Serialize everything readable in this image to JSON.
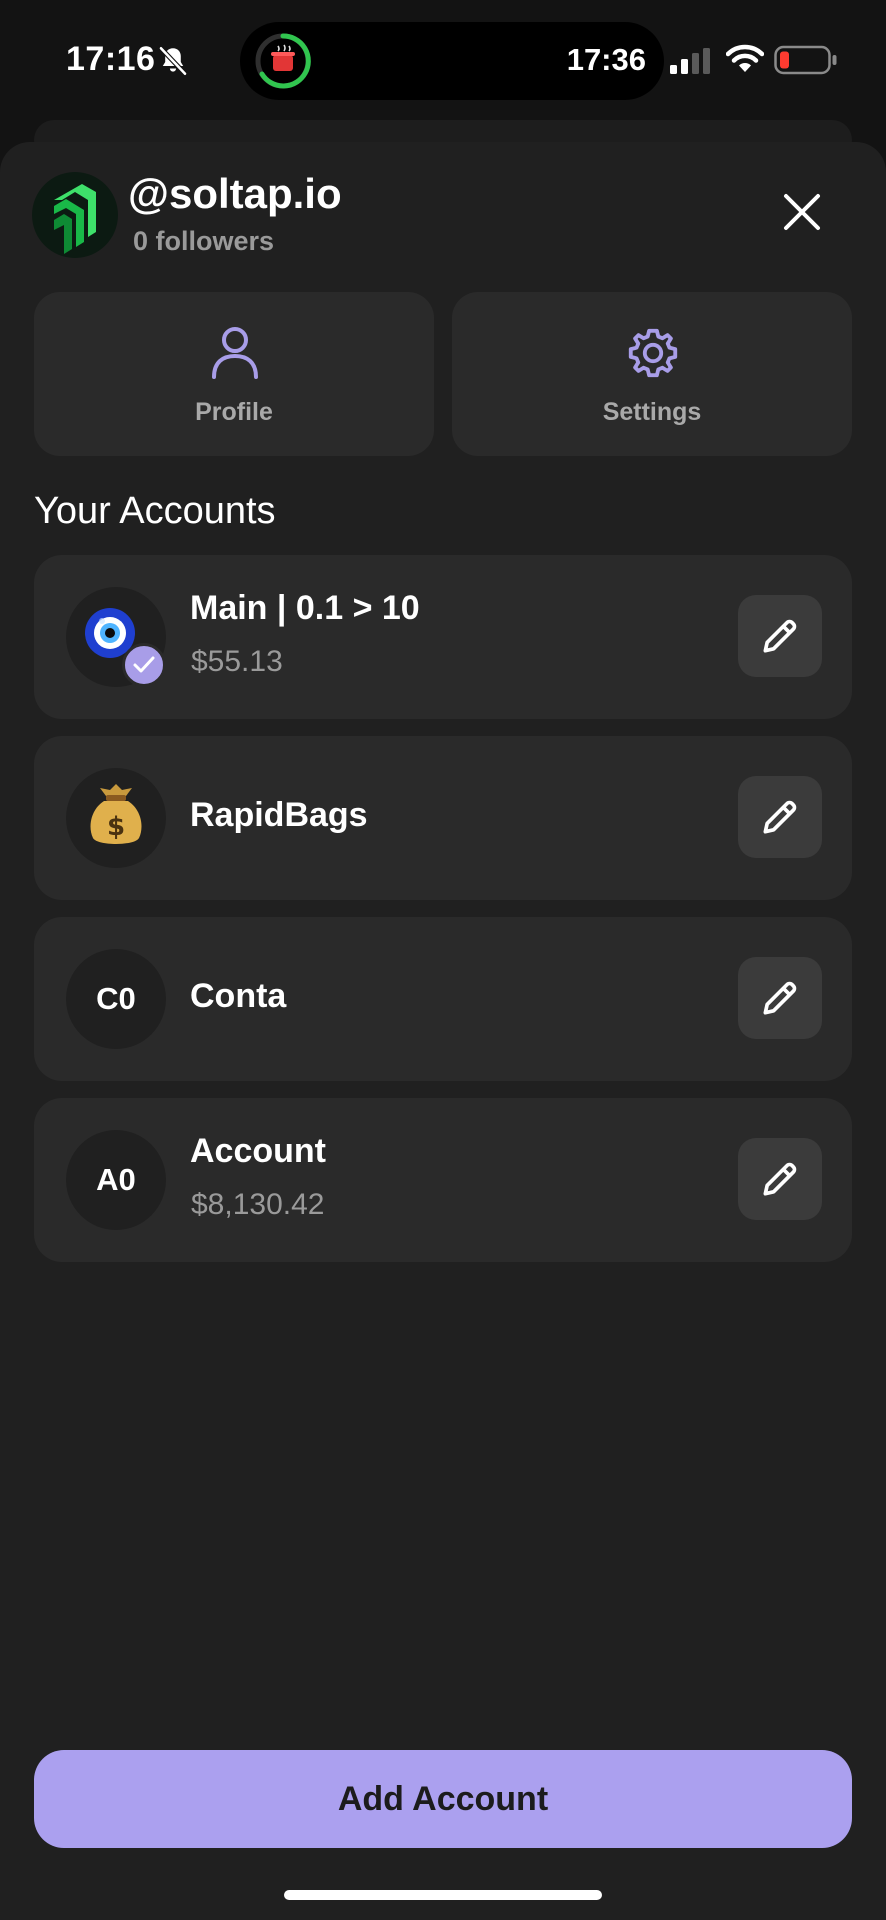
{
  "status_bar": {
    "time": "17:16",
    "island_time": "17:36",
    "icons": [
      "bell-slash-icon",
      "timer-ring-icon",
      "signal-icon",
      "wifi-icon",
      "battery-low-icon"
    ]
  },
  "profile": {
    "handle": "@soltap.io",
    "followers": "0 followers"
  },
  "tiles": [
    {
      "label": "Profile",
      "icon": "person-icon"
    },
    {
      "label": "Settings",
      "icon": "gear-icon"
    }
  ],
  "accounts_section": {
    "title": "Your Accounts"
  },
  "accounts": [
    {
      "name": "Main | 0.1 > 10",
      "balance": "$55.13",
      "avatar": "nazar-amulet-emoji",
      "selected": true
    },
    {
      "name": "RapidBags",
      "avatar": "money-bag-emoji"
    },
    {
      "name": "Conta",
      "initials": "C0"
    },
    {
      "name": "Account",
      "balance": "$8,130.42",
      "initials": "A0"
    }
  ],
  "add_button": {
    "label": "Add Account"
  },
  "colors": {
    "background": "#202020",
    "card": "#2a2a2a",
    "accent": "#aba0ef",
    "muted_text": "#9a9a9a",
    "brand_green": "#22c55e"
  }
}
